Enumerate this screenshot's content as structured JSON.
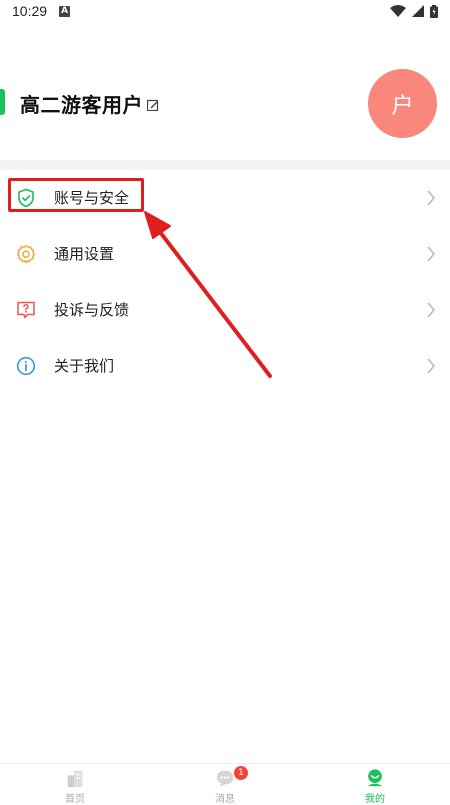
{
  "status_bar": {
    "time": "10:29",
    "notif_letter": "A"
  },
  "profile": {
    "name": "高二游客用户",
    "avatar_text": "户",
    "accent_color": "#19c05b",
    "avatar_color": "#f9877e"
  },
  "menu": {
    "items": [
      {
        "label": "账号与安全",
        "icon": "shield-check-icon"
      },
      {
        "label": "通用设置",
        "icon": "gear-icon"
      },
      {
        "label": "投诉与反馈",
        "icon": "question-box-icon"
      },
      {
        "label": "关于我们",
        "icon": "info-icon"
      }
    ]
  },
  "tabbar": {
    "tabs": [
      {
        "label": "首页",
        "icon": "home-building-icon",
        "active": false
      },
      {
        "label": "消息",
        "icon": "chat-bubble-icon",
        "active": false,
        "badge": "1"
      },
      {
        "label": "我的",
        "icon": "profile-icon",
        "active": true
      }
    ]
  },
  "annotation": {
    "color": "#e01e1e"
  }
}
